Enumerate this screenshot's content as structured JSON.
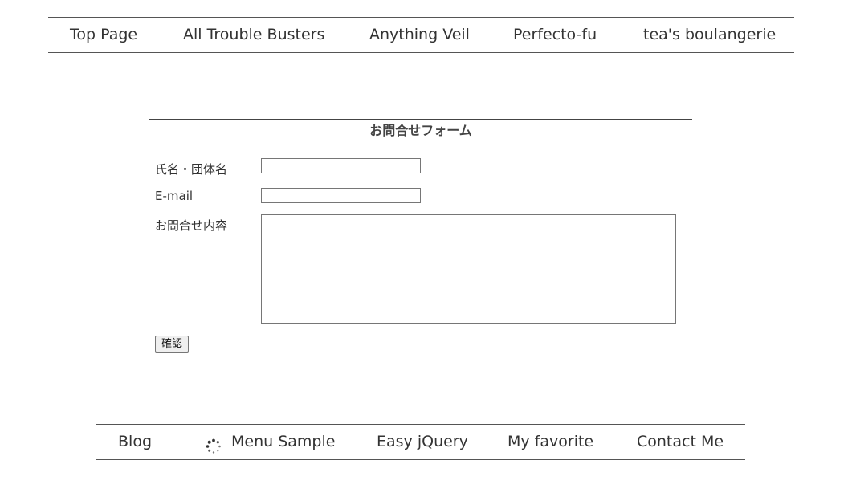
{
  "top_nav": {
    "items": [
      {
        "label": "Top Page"
      },
      {
        "label": "All Trouble Busters"
      },
      {
        "label": "Anything Veil"
      },
      {
        "label": "Perfecto-fu"
      },
      {
        "label": "tea's boulangerie"
      }
    ]
  },
  "form": {
    "title": "お問合せフォーム",
    "name_label": "氏名・団体名",
    "name_value": "",
    "email_label": "E-mail",
    "email_value": "",
    "message_label": "お問合せ内容",
    "message_value": "",
    "confirm_button": "確認"
  },
  "bottom_nav": {
    "items": [
      {
        "label": "Blog"
      },
      {
        "label": "Menu Sample",
        "icon": "loading-spinner-icon"
      },
      {
        "label": "Easy jQuery"
      },
      {
        "label": "My favorite"
      },
      {
        "label": "Contact Me"
      }
    ]
  },
  "colors": {
    "text": "#333333",
    "rule": "#555555",
    "background": "#ffffff"
  }
}
